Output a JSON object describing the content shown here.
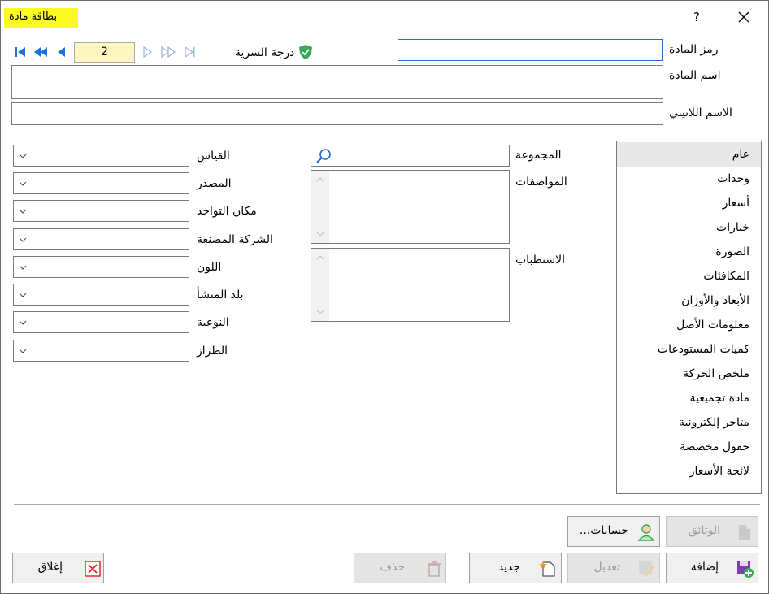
{
  "window": {
    "title": "بطاقة مادة",
    "help_label": "?",
    "close_label": "✕"
  },
  "header": {
    "code_label": "رمز المادة",
    "code_value": "",
    "name_label": "اسم المادة",
    "name_value": "",
    "latin_label": "الاسم اللاتيني",
    "latin_value": "",
    "security_label": "درجة السرية",
    "record_number": "2"
  },
  "tabs": [
    {
      "label": "عام"
    },
    {
      "label": "وحدات"
    },
    {
      "label": "أسعار"
    },
    {
      "label": "خيارات"
    },
    {
      "label": "الصورة"
    },
    {
      "label": "المكافئات"
    },
    {
      "label": "الأبعاد والأوزان"
    },
    {
      "label": "معلومات الأصل"
    },
    {
      "label": "كميات المستودعات"
    },
    {
      "label": "ملخص الحركة"
    },
    {
      "label": "مادة تجميعية"
    },
    {
      "label": "متاجر إلكترونية"
    },
    {
      "label": "حقول مخصصة"
    },
    {
      "label": "لائحة الأسعار"
    }
  ],
  "general": {
    "group_label": "المجموعة",
    "specs_label": "المواصفات",
    "barcode_label": "الاستطباب",
    "combos": [
      {
        "label": "القياس",
        "value": ""
      },
      {
        "label": "المصدر",
        "value": ""
      },
      {
        "label": "مكان التواجد",
        "value": ""
      },
      {
        "label": "الشركة المصنعة",
        "value": ""
      },
      {
        "label": "اللون",
        "value": ""
      },
      {
        "label": "بلد المنشأ",
        "value": ""
      },
      {
        "label": "النوعية",
        "value": ""
      },
      {
        "label": "الطراز",
        "value": ""
      }
    ]
  },
  "buttons": {
    "documents": "الوثائق",
    "accounts": "حسابات...",
    "add": "إضافة",
    "edit": "تعديل",
    "new": "جديد",
    "delete": "حذف",
    "close": "إغلاق"
  },
  "colors": {
    "title_highlight": "#fbfb23",
    "counter_bg": "#fdf6c3",
    "nav_blue": "#1e6fd9",
    "shield_green": "#3aa657",
    "close_red": "#e01e1e"
  }
}
